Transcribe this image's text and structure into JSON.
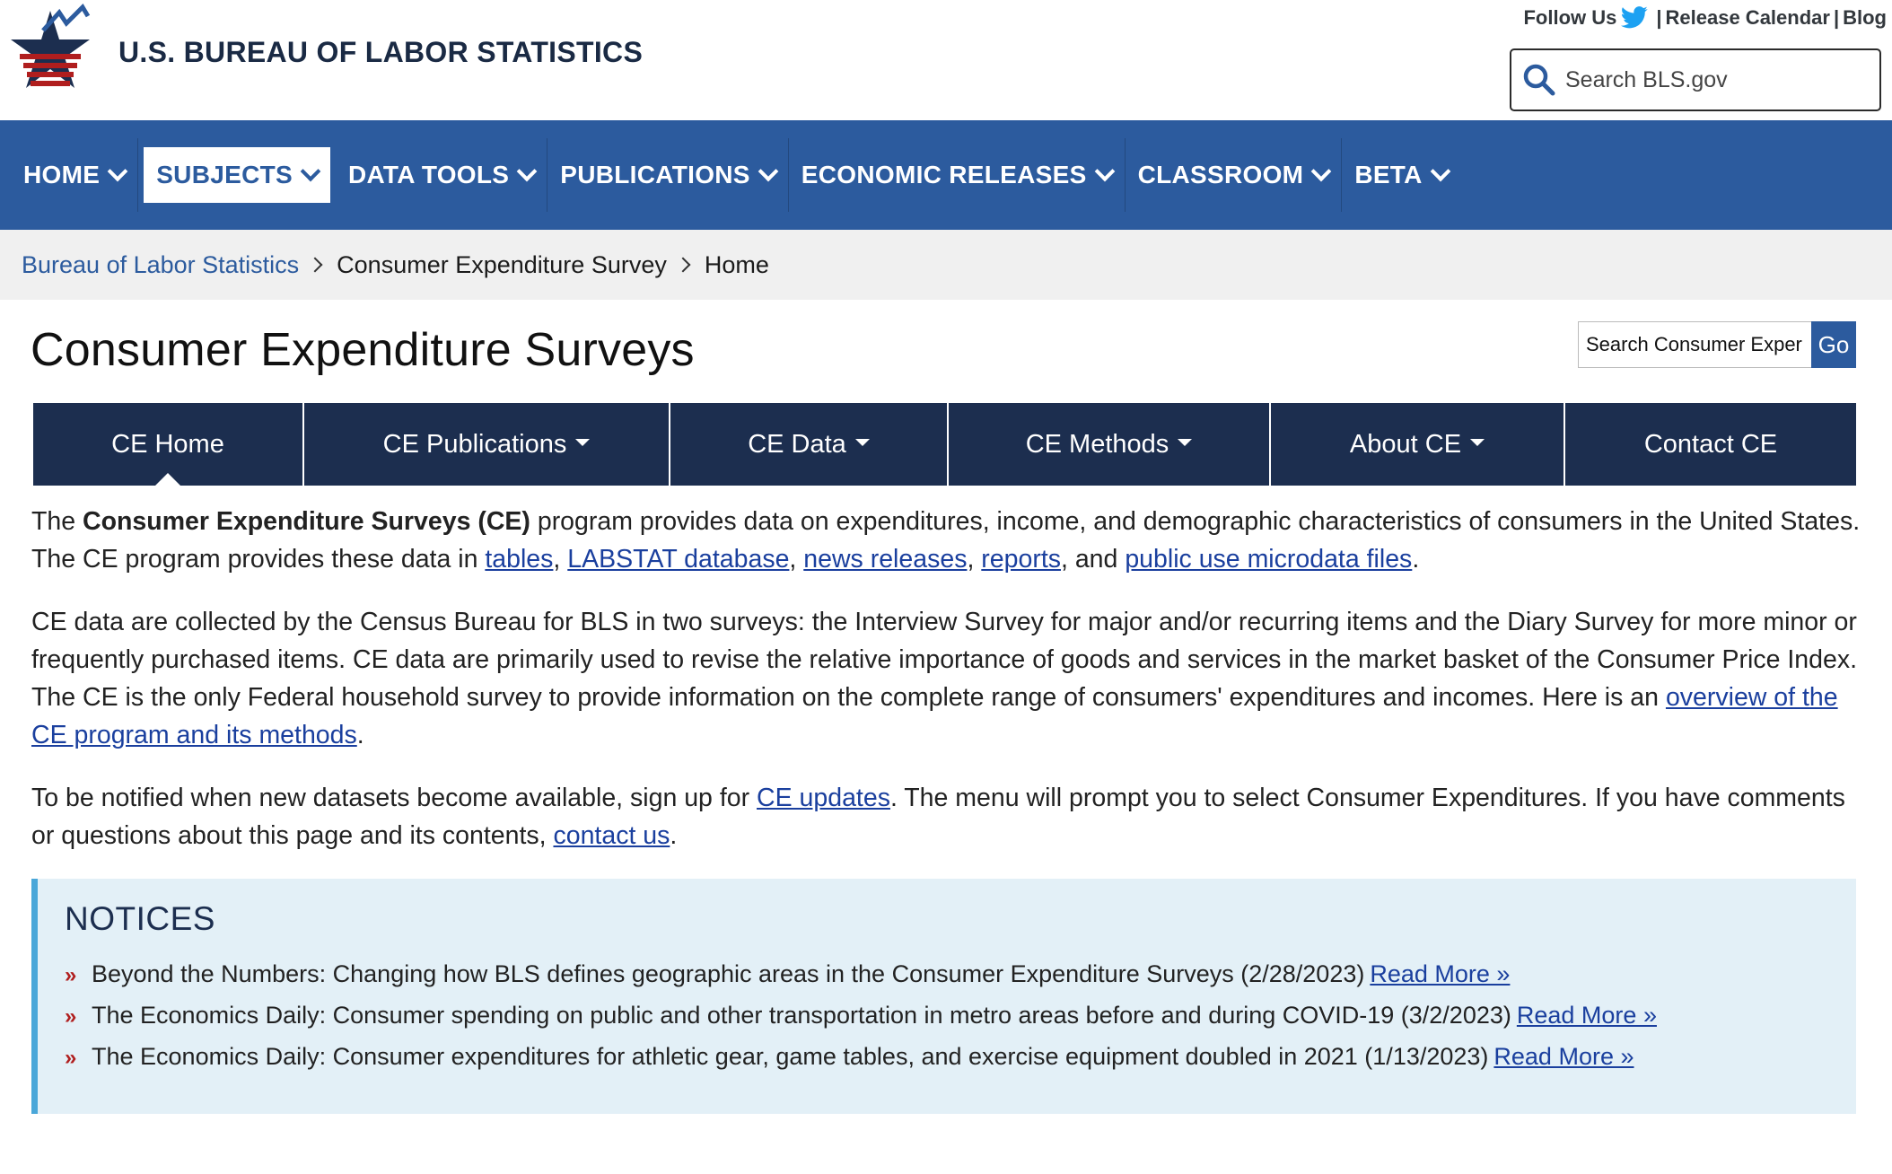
{
  "header": {
    "agency_name": "U.S. BUREAU OF LABOR STATISTICS",
    "follow_us": "Follow Us",
    "release_calendar": "Release Calendar",
    "blog": "Blog",
    "search_placeholder": "Search BLS.gov"
  },
  "main_nav": {
    "items": [
      {
        "label": "HOME"
      },
      {
        "label": "SUBJECTS"
      },
      {
        "label": "DATA TOOLS"
      },
      {
        "label": "PUBLICATIONS"
      },
      {
        "label": "ECONOMIC RELEASES"
      },
      {
        "label": "CLASSROOM"
      },
      {
        "label": "BETA"
      }
    ],
    "active": "SUBJECTS"
  },
  "breadcrumb": {
    "items": [
      "Bureau of Labor Statistics",
      "Consumer Expenditure Survey",
      "Home"
    ]
  },
  "page": {
    "title": "Consumer Expenditure Surveys",
    "ce_search_placeholder": "Search Consumer Exper",
    "go_label": "Go"
  },
  "ce_tabs": {
    "items": [
      {
        "label": "CE Home"
      },
      {
        "label": "CE Publications"
      },
      {
        "label": "CE Data"
      },
      {
        "label": "CE Methods"
      },
      {
        "label": "About CE"
      },
      {
        "label": "Contact CE"
      }
    ],
    "active": "CE Home"
  },
  "content": {
    "p1_start": "The ",
    "p1_bold": "Consumer Expenditure Surveys (CE)",
    "p1_mid": " program provides data on expenditures, income, and demographic characteristics of consumers in the United States. The CE program provides these data in ",
    "link_tables": "tables",
    "sep_comma": ", ",
    "link_labstat": "LABSTAT database",
    "link_news": "news releases",
    "link_reports": "reports",
    "sep_and": ", and ",
    "link_microdata": "public use microdata files",
    "period": ".",
    "p2_text": "CE data are collected by the Census Bureau for BLS in two surveys: the Interview Survey for major and/or recurring items and the Diary Survey for more minor or frequently purchased items. CE data are primarily used to revise the relative importance of goods and services in the market basket of the Consumer Price Index. The CE is the only Federal household survey to provide information on the complete range of consumers' expenditures and incomes. Here is an ",
    "p2_link": "overview of the CE program and its methods",
    "p3_text": "To be notified when new datasets become available, sign up for ",
    "p3_link1": "CE updates",
    "p3_mid": ". The menu will prompt you to select Consumer Expenditures. If you have comments or questions about this page and its contents, ",
    "p3_link2": "contact us"
  },
  "notices": {
    "heading": "NOTICES",
    "bullet": "»",
    "items": [
      {
        "text": "Beyond the Numbers: Changing how BLS defines geographic areas in the Consumer Expenditure Surveys (2/28/2023)",
        "link": "Read More »"
      },
      {
        "text": "The Economics Daily: Consumer spending on public and other transportation in metro areas before and during COVID-19 (3/2/2023)",
        "link": "Read More »"
      },
      {
        "text": "The Economics Daily: Consumer expenditures for athletic gear, game tables, and exercise equipment doubled in 2021 (1/13/2023)",
        "link": "Read More »"
      }
    ]
  },
  "colors": {
    "nav_blue": "#2c5b9e",
    "tab_navy": "#1c2e4f",
    "notice_bg": "#e3f0f7",
    "notice_accent": "#4aa7d9",
    "star_red": "#b01e1e"
  }
}
